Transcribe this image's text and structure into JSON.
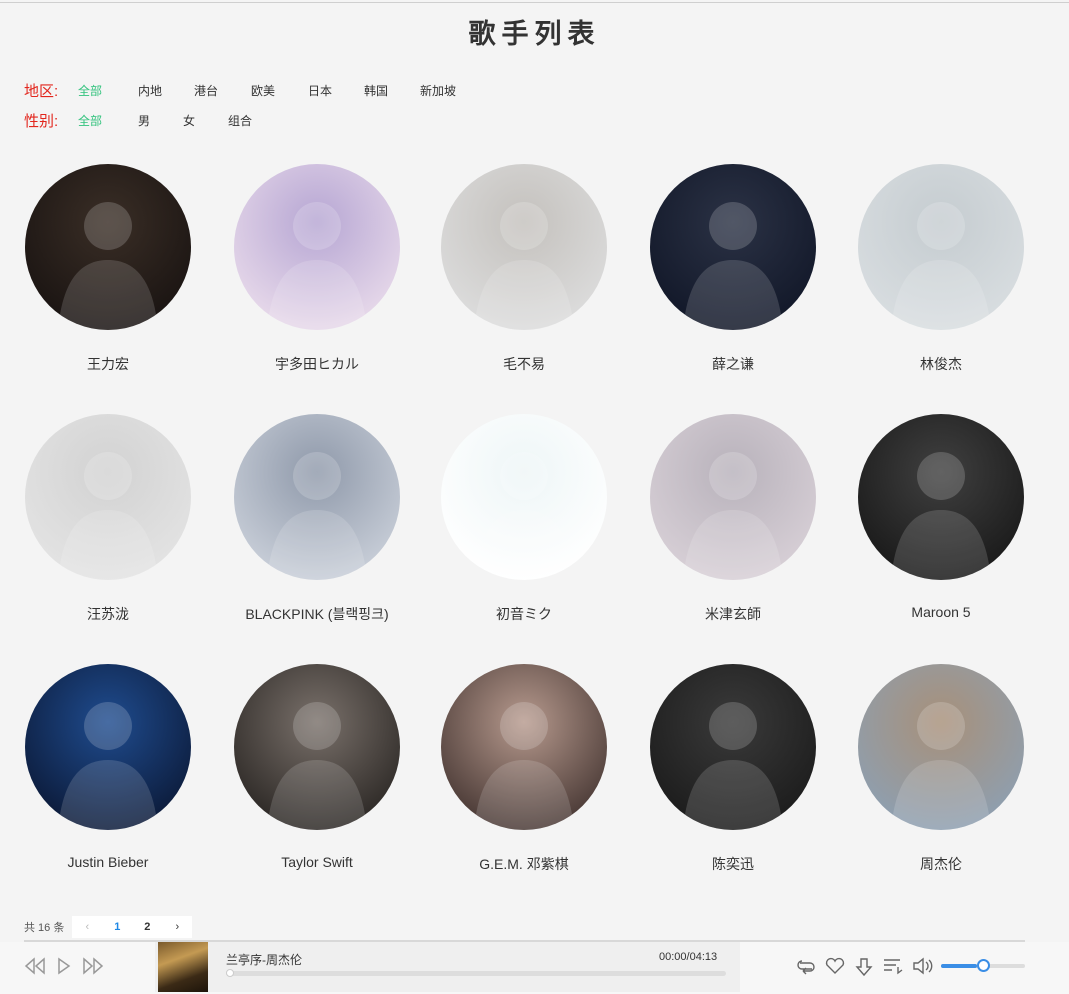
{
  "page": {
    "title": "歌手列表"
  },
  "filters": {
    "region": {
      "label": "地区:",
      "options": [
        "全部",
        "内地",
        "港台",
        "欧美",
        "日本",
        "韩国",
        "新加坡"
      ],
      "active": 0
    },
    "gender": {
      "label": "性别:",
      "options": [
        "全部",
        "男",
        "女",
        "组合"
      ],
      "active": 0
    }
  },
  "singers": [
    {
      "name": "王力宏",
      "bg": [
        "#1a1412",
        "#3a2e26"
      ]
    },
    {
      "name": "宇多田ヒカル",
      "bg": [
        "#e7d9ea",
        "#b6a6d3"
      ]
    },
    {
      "name": "毛不易",
      "bg": [
        "#dcdcdc",
        "#c4c1bd"
      ]
    },
    {
      "name": "薛之谦",
      "bg": [
        "#121829",
        "#2b3245"
      ]
    },
    {
      "name": "林俊杰",
      "bg": [
        "#d8dde0",
        "#c5ccd0"
      ]
    },
    {
      "name": "汪苏泷",
      "bg": [
        "#e3e3e3",
        "#d2d2d2"
      ]
    },
    {
      "name": "BLACKPINK (블랙핑크)",
      "bg": [
        "#c8ced8",
        "#8f99aa"
      ]
    },
    {
      "name": "初音ミク",
      "bg": [
        "#ffffff",
        "#eef6f7"
      ]
    },
    {
      "name": "米津玄師",
      "bg": [
        "#d7cfd6",
        "#b8b2bb"
      ]
    },
    {
      "name": "Maroon 5",
      "bg": [
        "#1a1a1a",
        "#404040"
      ]
    },
    {
      "name": "Justin Bieber",
      "bg": [
        "#0c1b3a",
        "#1f4c8f"
      ]
    },
    {
      "name": "Taylor Swift",
      "bg": [
        "#2d2926",
        "#7a716b"
      ]
    },
    {
      "name": "G.E.M. 邓紫棋",
      "bg": [
        "#4a3a36",
        "#b79a8e"
      ]
    },
    {
      "name": "陈奕迅",
      "bg": [
        "#1c1c1c",
        "#3a3a3a"
      ]
    },
    {
      "name": "周杰伦",
      "bg": [
        "#8e9fb0",
        "#a89079"
      ]
    }
  ],
  "pagination": {
    "total": "共 16 条",
    "pages": [
      "1",
      "2"
    ],
    "current": "1",
    "prev": "‹",
    "next": "›"
  },
  "player": {
    "song_title": "兰亭序-周杰伦",
    "time": "00:00/04:13",
    "progress": 0,
    "volume": 0.5,
    "accent": "#3a8ee6"
  }
}
